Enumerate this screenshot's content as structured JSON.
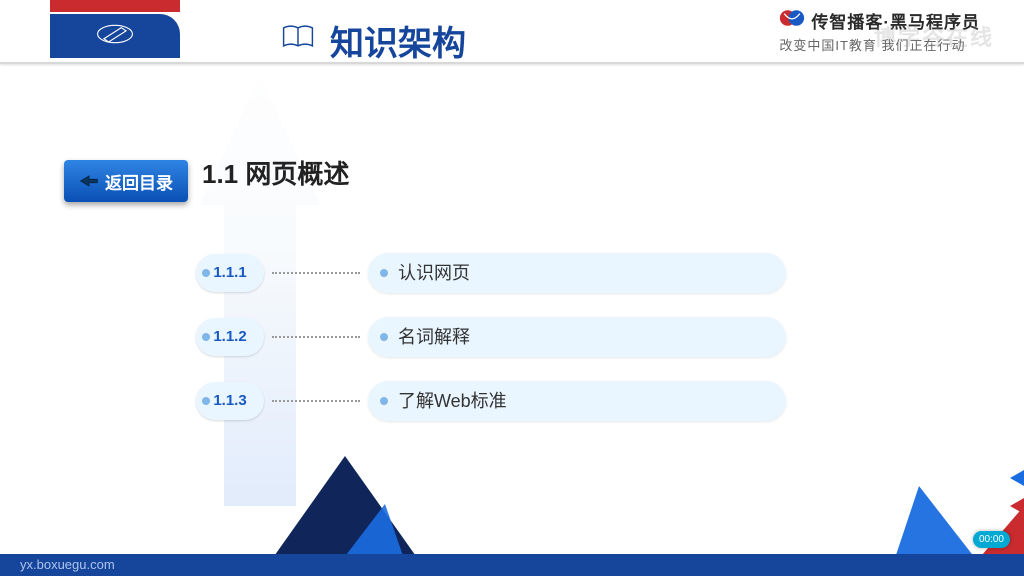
{
  "header": {
    "title": "知识架构",
    "brand_main": "传智播客·黑马程序员",
    "brand_sub": "改变中国IT教育 我们正在行动",
    "watermark": "博学谷在线"
  },
  "nav": {
    "back_label": "返回目录"
  },
  "section": {
    "heading": "1.1  网页概述"
  },
  "items": [
    {
      "num": "1.1.1",
      "label": "认识网页"
    },
    {
      "num": "1.1.2",
      "label": "名词解释"
    },
    {
      "num": "1.1.3",
      "label": "了解Web标准"
    }
  ],
  "footer": {
    "url": "yx.boxuegu.com",
    "timestamp": "00:00"
  }
}
